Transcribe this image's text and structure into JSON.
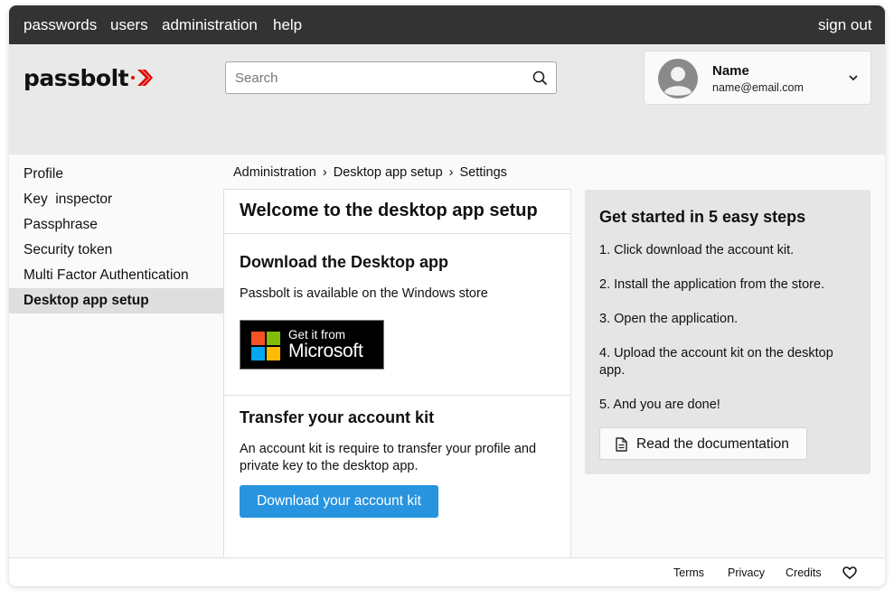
{
  "topnav": {
    "items": [
      "passwords",
      "users",
      "administration",
      "help"
    ],
    "signout": "sign out"
  },
  "brand": {
    "logo_text": "passbolt",
    "accent_color": "#e10600"
  },
  "search": {
    "placeholder": "Search",
    "icon": "search-icon"
  },
  "user": {
    "name": "Name",
    "email": "name@email.com"
  },
  "sidebar": {
    "items": [
      {
        "label": "Profile"
      },
      {
        "label": "Key  inspector"
      },
      {
        "label": "Passphrase"
      },
      {
        "label": "Security token"
      },
      {
        "label": "Multi Factor Authentication"
      },
      {
        "label": "Desktop app setup",
        "active": true
      }
    ]
  },
  "breadcrumb": {
    "items": [
      "Administration",
      "Desktop app setup",
      "Settings"
    ],
    "separator": "›"
  },
  "main": {
    "title": "Welcome to the desktop app setup",
    "download_heading": "Download the Desktop app",
    "download_text": "Passbolt is available on the Windows store",
    "store_badge": {
      "line1": "Get it from",
      "line2": "Microsoft"
    },
    "transfer_heading": "Transfer your account kit",
    "transfer_text": "An account kit is require to transfer your profile and private key to the desktop app.",
    "download_button": "Download your account kit",
    "primary_color": "#2894df"
  },
  "steps": {
    "title": "Get started in 5 easy steps",
    "items": [
      "1. Click download the account kit.",
      "2. Install the application from the store.",
      "3. Open the application.",
      "4. Upload the account kit on the desktop app.",
      "5. And you are done!"
    ],
    "doc_button": "Read the documentation"
  },
  "footer": {
    "links": [
      "Terms",
      "Privacy",
      "Credits"
    ],
    "icon": "heart-icon"
  }
}
